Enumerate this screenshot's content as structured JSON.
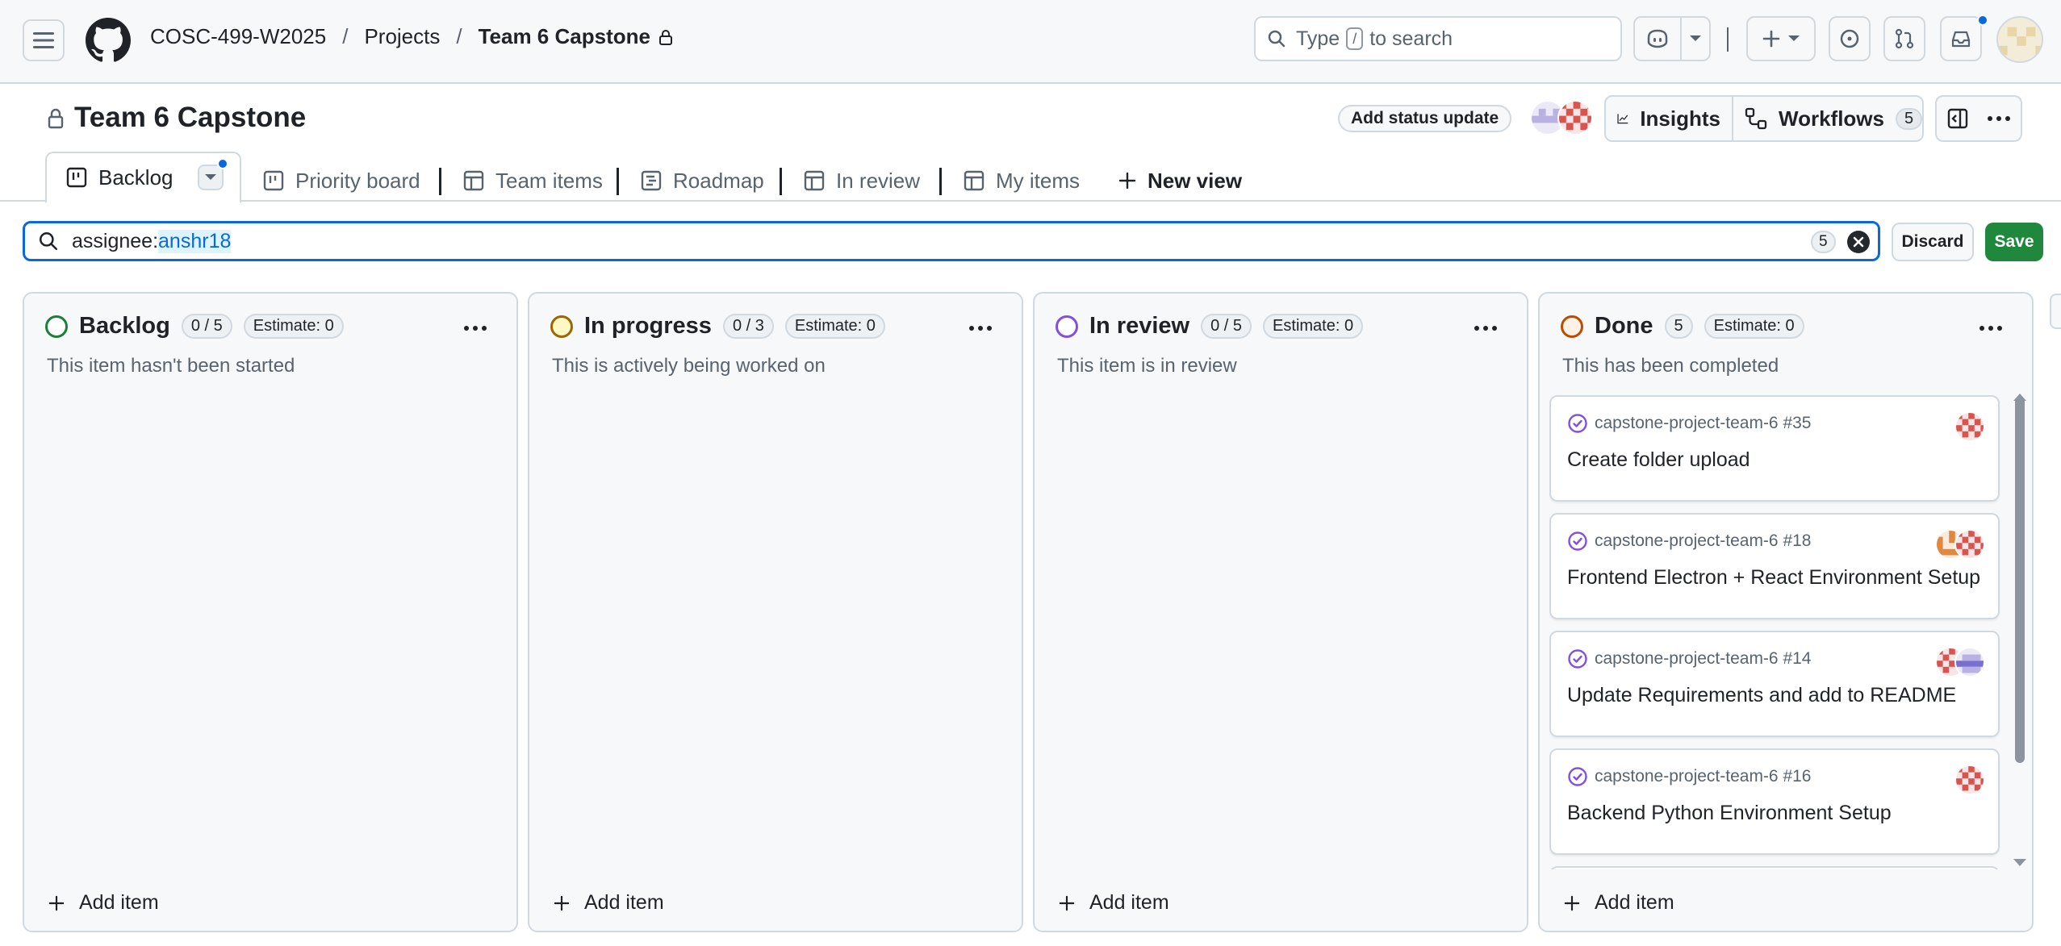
{
  "header": {
    "breadcrumbs": [
      "COSC-499-W2025",
      "Projects",
      "Team 6 Capstone"
    ],
    "separator": "/",
    "search": {
      "prefix": "Type",
      "key": "/",
      "suffix": "to search"
    }
  },
  "project": {
    "title": "Team 6 Capstone",
    "add_status_update": "Add status update",
    "insights_label": "Insights",
    "workflows_label": "Workflows",
    "workflows_count": "5"
  },
  "views": {
    "tabs": [
      {
        "label": "Backlog",
        "icon": "board-icon",
        "active": true
      },
      {
        "label": "Priority board",
        "icon": "board-icon"
      },
      {
        "label": "Team items",
        "icon": "table-icon"
      },
      {
        "label": "Roadmap",
        "icon": "roadmap-icon"
      },
      {
        "label": "In review",
        "icon": "table-icon"
      },
      {
        "label": "My items",
        "icon": "table-icon"
      }
    ],
    "new_view": "New view"
  },
  "filter": {
    "key": "assignee:",
    "value": "anshr18",
    "count": "5",
    "discard": "Discard",
    "save": "Save"
  },
  "columns": [
    {
      "name": "Backlog",
      "count": "0 / 5",
      "estimate": "Estimate: 0",
      "description": "This item hasn't been started",
      "color": "#1a7f37",
      "add_item": "Add item"
    },
    {
      "name": "In progress",
      "count": "0 / 3",
      "estimate": "Estimate: 0",
      "description": "This is actively being worked on",
      "color": "#9a6700",
      "add_item": "Add item"
    },
    {
      "name": "In review",
      "count": "0 / 5",
      "estimate": "Estimate: 0",
      "description": "This item is in review",
      "color": "#8250df",
      "add_item": "Add item"
    },
    {
      "name": "Done",
      "count": "5",
      "estimate": "Estimate: 0",
      "description": "This has been completed",
      "color": "#bc4c00",
      "add_item": "Add item"
    }
  ],
  "cards": [
    {
      "ref": "capstone-project-team-6 #35",
      "title": "Create folder upload"
    },
    {
      "ref": "capstone-project-team-6 #18",
      "title": "Frontend Electron + React Environment Setup"
    },
    {
      "ref": "capstone-project-team-6 #14",
      "title": "Update Requirements and add to README"
    },
    {
      "ref": "capstone-project-team-6 #16",
      "title": "Backend Python Environment Setup"
    }
  ],
  "colors": {
    "accent": "#0969da",
    "save_green": "#1f883d",
    "done_purple": "#8250df"
  }
}
